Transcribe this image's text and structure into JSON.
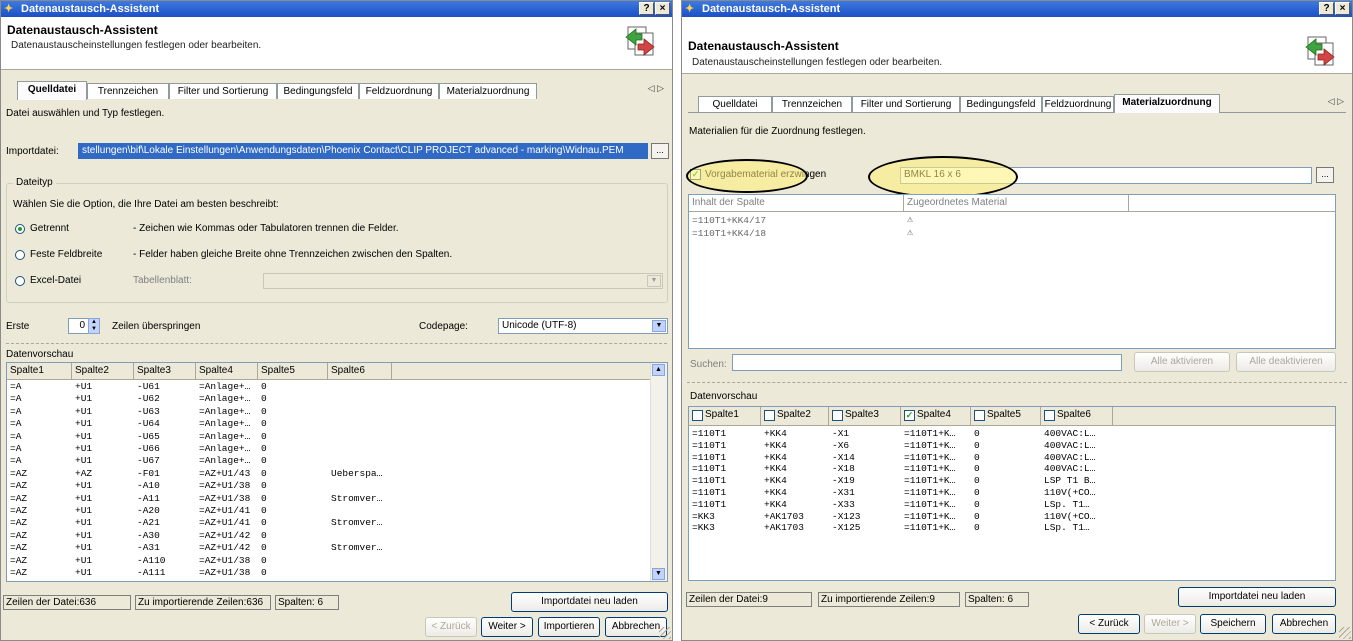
{
  "window_title": "Datenaustausch-Assistent",
  "title_help": "?",
  "title_close": "×",
  "header_title": "Datenaustausch-Assistent",
  "header_sub": "Datenaustauscheinstellungen festlegen oder bearbeiten.",
  "tab_scroll": "◁ ▷",
  "ellipsis": "...",
  "left": {
    "tabs": [
      "Quelldatei",
      "Trennzeichen",
      "Filter und Sortierung",
      "Bedingungsfeld",
      "Feldzuordnung",
      "Materialzuordnung"
    ],
    "instruction": "Datei auswählen und Typ festlegen.",
    "import_label": "Importdatei:",
    "import_path": "stellungen\\bif\\Lokale Einstellungen\\Anwendungsdaten\\Phoenix Contact\\CLIP PROJECT advanced - marking\\Widnau.PEM",
    "dateityp": {
      "title": "Dateityp",
      "hint": "Wählen Sie die Option, die Ihre Datei am besten beschreibt:",
      "opt1_label": "Getrennt",
      "opt1_desc": "- Zeichen wie Kommas oder Tabulatoren trennen die Felder.",
      "opt2_label": "Feste Feldbreite",
      "opt2_desc": "- Felder haben gleiche Breite ohne Trennzeichen zwischen den Spalten.",
      "opt3_label": "Excel-Datei",
      "tabellenblatt": "Tabellenblatt:"
    },
    "erste_label": "Erste",
    "erste_value": "0",
    "skip_label": "Zeilen überspringen",
    "codepage_label": "Codepage:",
    "codepage_value": "Unicode (UTF-8)",
    "preview_title": "Datenvorschau",
    "columns": [
      "Spalte1",
      "Spalte2",
      "Spalte3",
      "Spalte4",
      "Spalte5",
      "Spalte6"
    ],
    "rows": [
      [
        "=A",
        "+U1",
        "-U61",
        "=Anlage+…",
        "0",
        ""
      ],
      [
        "=A",
        "+U1",
        "-U62",
        "=Anlage+…",
        "0",
        ""
      ],
      [
        "=A",
        "+U1",
        "-U63",
        "=Anlage+…",
        "0",
        ""
      ],
      [
        "=A",
        "+U1",
        "-U64",
        "=Anlage+…",
        "0",
        ""
      ],
      [
        "=A",
        "+U1",
        "-U65",
        "=Anlage+…",
        "0",
        ""
      ],
      [
        "=A",
        "+U1",
        "-U66",
        "=Anlage+…",
        "0",
        ""
      ],
      [
        "=A",
        "+U1",
        "-U67",
        "=Anlage+…",
        "0",
        ""
      ],
      [
        "=AZ",
        "+AZ",
        "-F01",
        "=AZ+U1/43",
        "0",
        "Ueberspa…"
      ],
      [
        "=AZ",
        "+U1",
        "-A10",
        "=AZ+U1/38",
        "0",
        ""
      ],
      [
        "=AZ",
        "+U1",
        "-A11",
        "=AZ+U1/38",
        "0",
        "Stromver…"
      ],
      [
        "=AZ",
        "+U1",
        "-A20",
        "=AZ+U1/41",
        "0",
        ""
      ],
      [
        "=AZ",
        "+U1",
        "-A21",
        "=AZ+U1/41",
        "0",
        "Stromver…"
      ],
      [
        "=AZ",
        "+U1",
        "-A30",
        "=AZ+U1/42",
        "0",
        ""
      ],
      [
        "=AZ",
        "+U1",
        "-A31",
        "=AZ+U1/42",
        "0",
        "Stromver…"
      ],
      [
        "=AZ",
        "+U1",
        "-A110",
        "=AZ+U1/38",
        "0",
        ""
      ],
      [
        "=AZ",
        "+U1",
        "-A111",
        "=AZ+U1/38",
        "0",
        ""
      ]
    ],
    "status_lines": "Zeilen der Datei:636",
    "status_import": "Zu importierende Zeilen:636",
    "status_cols": "Spalten: 6",
    "reload": "Importdatei neu laden",
    "back": "< Zurück",
    "next": "Weiter >",
    "finish": "Importieren",
    "cancel": "Abbrechen"
  },
  "right": {
    "tabs": [
      "Quelldatei",
      "Trennzeichen",
      "Filter und Sortierung",
      "Bedingungsfeld",
      "Feldzuordnung",
      "Materialzuordnung"
    ],
    "instruction": "Materialien für die Zuordnung festlegen.",
    "force_label": "Vorgabematerial erzwingen",
    "material_value": "BMKL 16 x 6",
    "map_columns": [
      "Inhalt der Spalte",
      "Zugeordnetes Material"
    ],
    "map_rows": [
      "=110T1+KK4/17",
      "=110T1+KK4/18"
    ],
    "warn_icon": "⚠",
    "search_label": "Suchen:",
    "activate_all": "Alle aktivieren",
    "deactivate_all": "Alle deaktivieren",
    "preview_title": "Datenvorschau",
    "columns": [
      "Spalte1",
      "Spalte2",
      "Spalte3",
      "Spalte4",
      "Spalte5",
      "Spalte6"
    ],
    "checked_column": 3,
    "check_mark": "✓",
    "rows": [
      [
        "=110T1",
        "+KK4",
        "-X1",
        "=110T1+K…",
        "0",
        "400VAC:L…"
      ],
      [
        "=110T1",
        "+KK4",
        "-X6",
        "=110T1+K…",
        "0",
        "400VAC:L…"
      ],
      [
        "=110T1",
        "+KK4",
        "-X14",
        "=110T1+K…",
        "0",
        "400VAC:L…"
      ],
      [
        "=110T1",
        "+KK4",
        "-X18",
        "=110T1+K…",
        "0",
        "400VAC:L…"
      ],
      [
        "=110T1",
        "+KK4",
        "-X19",
        "=110T1+K…",
        "0",
        "LSP T1 B…"
      ],
      [
        "=110T1",
        "+KK4",
        "-X31",
        "=110T1+K…",
        "0",
        "110V(+CO…"
      ],
      [
        "=110T1",
        "+KK4",
        "-X33",
        "=110T1+K…",
        "0",
        "LSp. T1…"
      ],
      [
        "=KK3",
        "+AK1703",
        "-X123",
        "=110T1+K…",
        "0",
        "110V(+CO…"
      ],
      [
        "=KK3",
        "+AK1703",
        "-X125",
        "=110T1+K…",
        "0",
        "LSp. T1…"
      ]
    ],
    "status_lines": "Zeilen der Datei:9",
    "status_import": "Zu importierende Zeilen:9",
    "status_cols": "Spalten: 6",
    "reload": "Importdatei neu laden",
    "back": "< Zurück",
    "next": "Weiter >",
    "finish": "Speichern",
    "cancel": "Abbrechen"
  }
}
